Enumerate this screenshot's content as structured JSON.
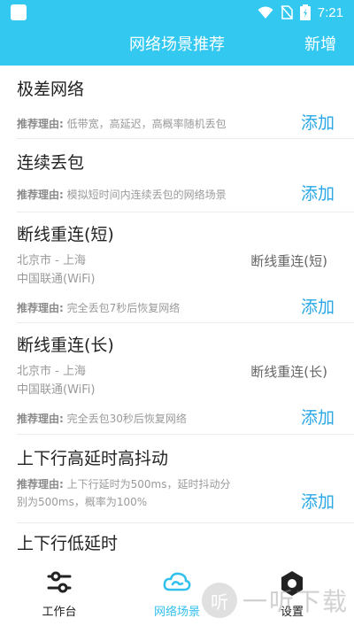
{
  "status_bar": {
    "time": "7:21"
  },
  "header": {
    "title": "网络场景推荐",
    "action": "新增"
  },
  "reason_prefix": "推荐理由:",
  "add_label": "添加",
  "items": [
    {
      "title": "极差网络",
      "reason": "低带宽，高延迟，高概率随机丢包"
    },
    {
      "title": "连续丢包",
      "reason": "模拟短时间内连续丢包的网络场景"
    },
    {
      "title": "断线重连(短)",
      "location": "北京市 - 上海",
      "carrier": "中国联通(WiFi)",
      "scene": "断线重连(短)",
      "reason": "完全丢包7秒后恢复网络"
    },
    {
      "title": "断线重连(长)",
      "location": "北京市 - 上海",
      "carrier": "中国联通(WiFi)",
      "scene": "断线重连(长)",
      "reason": "完全丢包30秒后恢复网络"
    },
    {
      "title": "上下行高延时高抖动",
      "reason_line1": "上下行延时为500ms，延时抖动分",
      "reason_line2": "别为500ms，概率为100%"
    },
    {
      "title": "上下行低延时"
    }
  ],
  "tabs": [
    {
      "label": "工作台",
      "icon": "sliders-icon"
    },
    {
      "label": "网络场景",
      "icon": "cloud-icon"
    },
    {
      "label": "设置",
      "icon": "settings-icon"
    }
  ],
  "watermark": {
    "text": "一听下载",
    "badge": "听"
  },
  "colors": {
    "primary": "#33c8f0",
    "accent": "#2aa7e6",
    "active_tab": "#33c0ec"
  }
}
